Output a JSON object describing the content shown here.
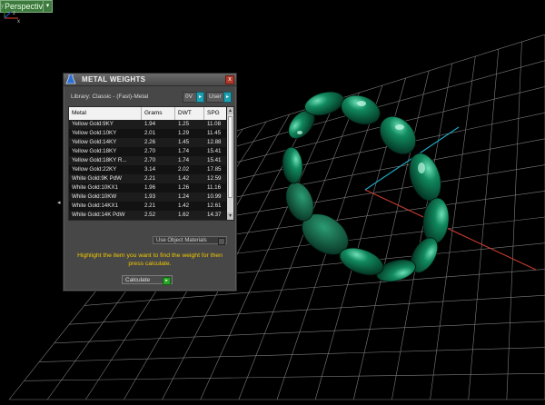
{
  "viewport": {
    "label": "Perspective",
    "menu_arrow": "▾",
    "axis_labels": {
      "y": "y",
      "x": "x",
      "z": "z"
    }
  },
  "panel": {
    "title": "METAL WEIGHTS",
    "close": "x",
    "library_label": "Library: Classic - (Fast)-Metal",
    "units_value": "0V",
    "units_btn": "▸",
    "mode_value": "User",
    "mode_btn": "▸",
    "columns": [
      "Metal",
      "Grams",
      "DWT",
      "SPG"
    ],
    "rows": [
      [
        "Yellow Gold:9KY",
        "1.94",
        "1.25",
        "11.08"
      ],
      [
        "Yellow Gold:10KY",
        "2.01",
        "1.29",
        "11.45"
      ],
      [
        "Yellow Gold:14KY",
        "2.26",
        "1.45",
        "12.88"
      ],
      [
        "Yellow Gold:18KY",
        "2.70",
        "1.74",
        "15.41"
      ],
      [
        "Yellow Gold:18KY R...",
        "2.70",
        "1.74",
        "15.41"
      ],
      [
        "Yellow Gold:22KY",
        "3.14",
        "2.02",
        "17.85"
      ],
      [
        "White Gold:9K PdW",
        "2.21",
        "1.42",
        "12.59"
      ],
      [
        "White Gold:10KX1",
        "1.96",
        "1.26",
        "11.16"
      ],
      [
        "White Gold:10KW",
        "1.93",
        "1.24",
        "10.99"
      ],
      [
        "White Gold:14KX1",
        "2.21",
        "1.42",
        "12.61"
      ],
      [
        "White Gold:14K PdW",
        "2.52",
        "1.62",
        "14.37"
      ]
    ],
    "scroll_up": "▴",
    "scroll_down": "▾",
    "use_object_materials": "Use Object Materials",
    "instructions": "Highlight the item you want to find the weight for then press calculate.",
    "calculate_label": "Calculate",
    "calculate_go": "▸",
    "side_arrow": "◂"
  },
  "colors": {
    "ring": "#0d7a58",
    "grid": "#8a8a8a",
    "axis_x": "#c0392b",
    "axis_y": "#1fa5c0",
    "panel_bg": "#474747",
    "instructions": "#f0c800"
  }
}
